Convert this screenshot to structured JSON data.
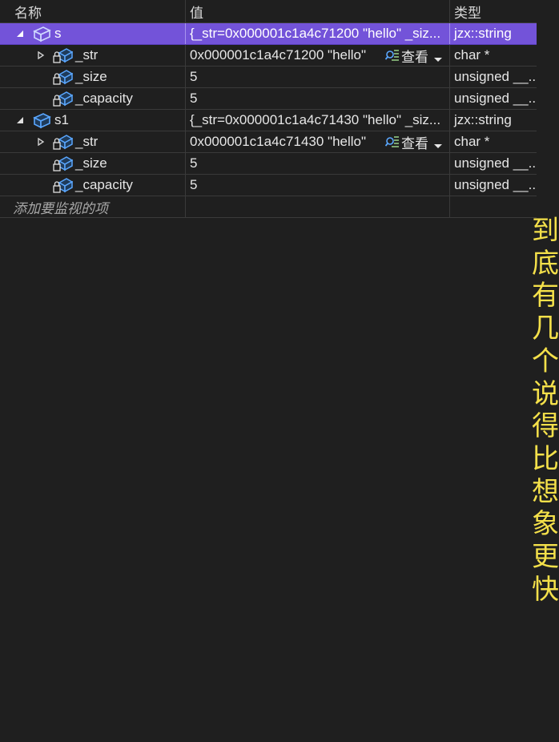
{
  "columns": {
    "name": "名称",
    "value": "值",
    "type": "类型"
  },
  "rows": [
    {
      "name": "s",
      "value": "{_str=0x000001c1a4c71200 \"hello\" _siz...",
      "type": "jzx::string",
      "selected": true,
      "expanded": true,
      "level": 0
    },
    {
      "name": "_str",
      "value": "0x000001c1a4c71200 \"hello\"",
      "type": "char *",
      "collapsed": true,
      "level": 1,
      "viewer": "查看"
    },
    {
      "name": "_size",
      "value": "5",
      "type": "unsigned __...",
      "level": 1
    },
    {
      "name": "_capacity",
      "value": "5",
      "type": "unsigned __...",
      "level": 1
    },
    {
      "name": "s1",
      "value": "{_str=0x000001c1a4c71430 \"hello\" _siz...",
      "type": "jzx::string",
      "expanded": true,
      "level": 0
    },
    {
      "name": "_str",
      "value": "0x000001c1a4c71430 \"hello\"",
      "type": "char *",
      "collapsed": true,
      "level": 1,
      "viewer": "查看"
    },
    {
      "name": "_size",
      "value": "5",
      "type": "unsigned __...",
      "level": 1
    },
    {
      "name": "_capacity",
      "value": "5",
      "type": "unsigned __...",
      "level": 1
    }
  ],
  "add_watch_placeholder": "添加要监视的项",
  "overlay_text": "到底有几个说得比想象更快",
  "icons": {
    "object": "object-icon",
    "member": "private-member-icon",
    "viewer": "text-visualizer-icon"
  },
  "colors": {
    "selection": "#7353d9",
    "overlay": "#f4e04a",
    "background": "#1f1f1f"
  }
}
